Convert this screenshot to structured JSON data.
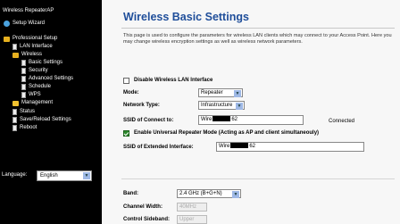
{
  "sidebar": {
    "header": "Wireless RepeaterAP",
    "setup_wizard": "Setup Wizard",
    "professional_setup": "Professional Setup",
    "lan_interface": "LAN Interface",
    "wireless": "Wireless",
    "basic_settings": "Basic Settings",
    "security": "Security",
    "advanced_settings": "Advanced Settings",
    "schedule": "Schedule",
    "wps": "WPS",
    "management": "Management",
    "status": "Status",
    "save_reload": "Save/Reload Settings",
    "reboot": "Reboot",
    "language_label": "Language:",
    "language_value": "English"
  },
  "main": {
    "title": "Wireless Basic Settings",
    "description": "This page is used to configure the parameters for wireless LAN clients which may connect to your Access Point. Here you may change wireless encryption settings as well as wireless network parameters.",
    "disable_label": "Disable Wireless LAN Interface",
    "mode_label": "Mode:",
    "mode_value": "Repeater",
    "network_type_label": "Network Type:",
    "network_type_value": "Infrastructure",
    "ssid_connect_label": "SSID of Connect to:",
    "ssid_connect_prefix": "Wire",
    "ssid_connect_suffix": "62",
    "connected_status": "Connected",
    "universal_repeater_label": "Enable Universal Repeater Mode (Acting as AP and client simultaneouly)",
    "ssid_extended_label": "SSID of Extended Interface:",
    "ssid_extended_prefix": "Wire",
    "ssid_extended_suffix": "62",
    "band_label": "Band:",
    "band_value": "2.4 GHz (B+G+N)",
    "channel_width_label": "Channel Width:",
    "channel_width_value": "40MHz",
    "control_sideband_label": "Control Sideband:",
    "control_sideband_value": "Upper"
  }
}
